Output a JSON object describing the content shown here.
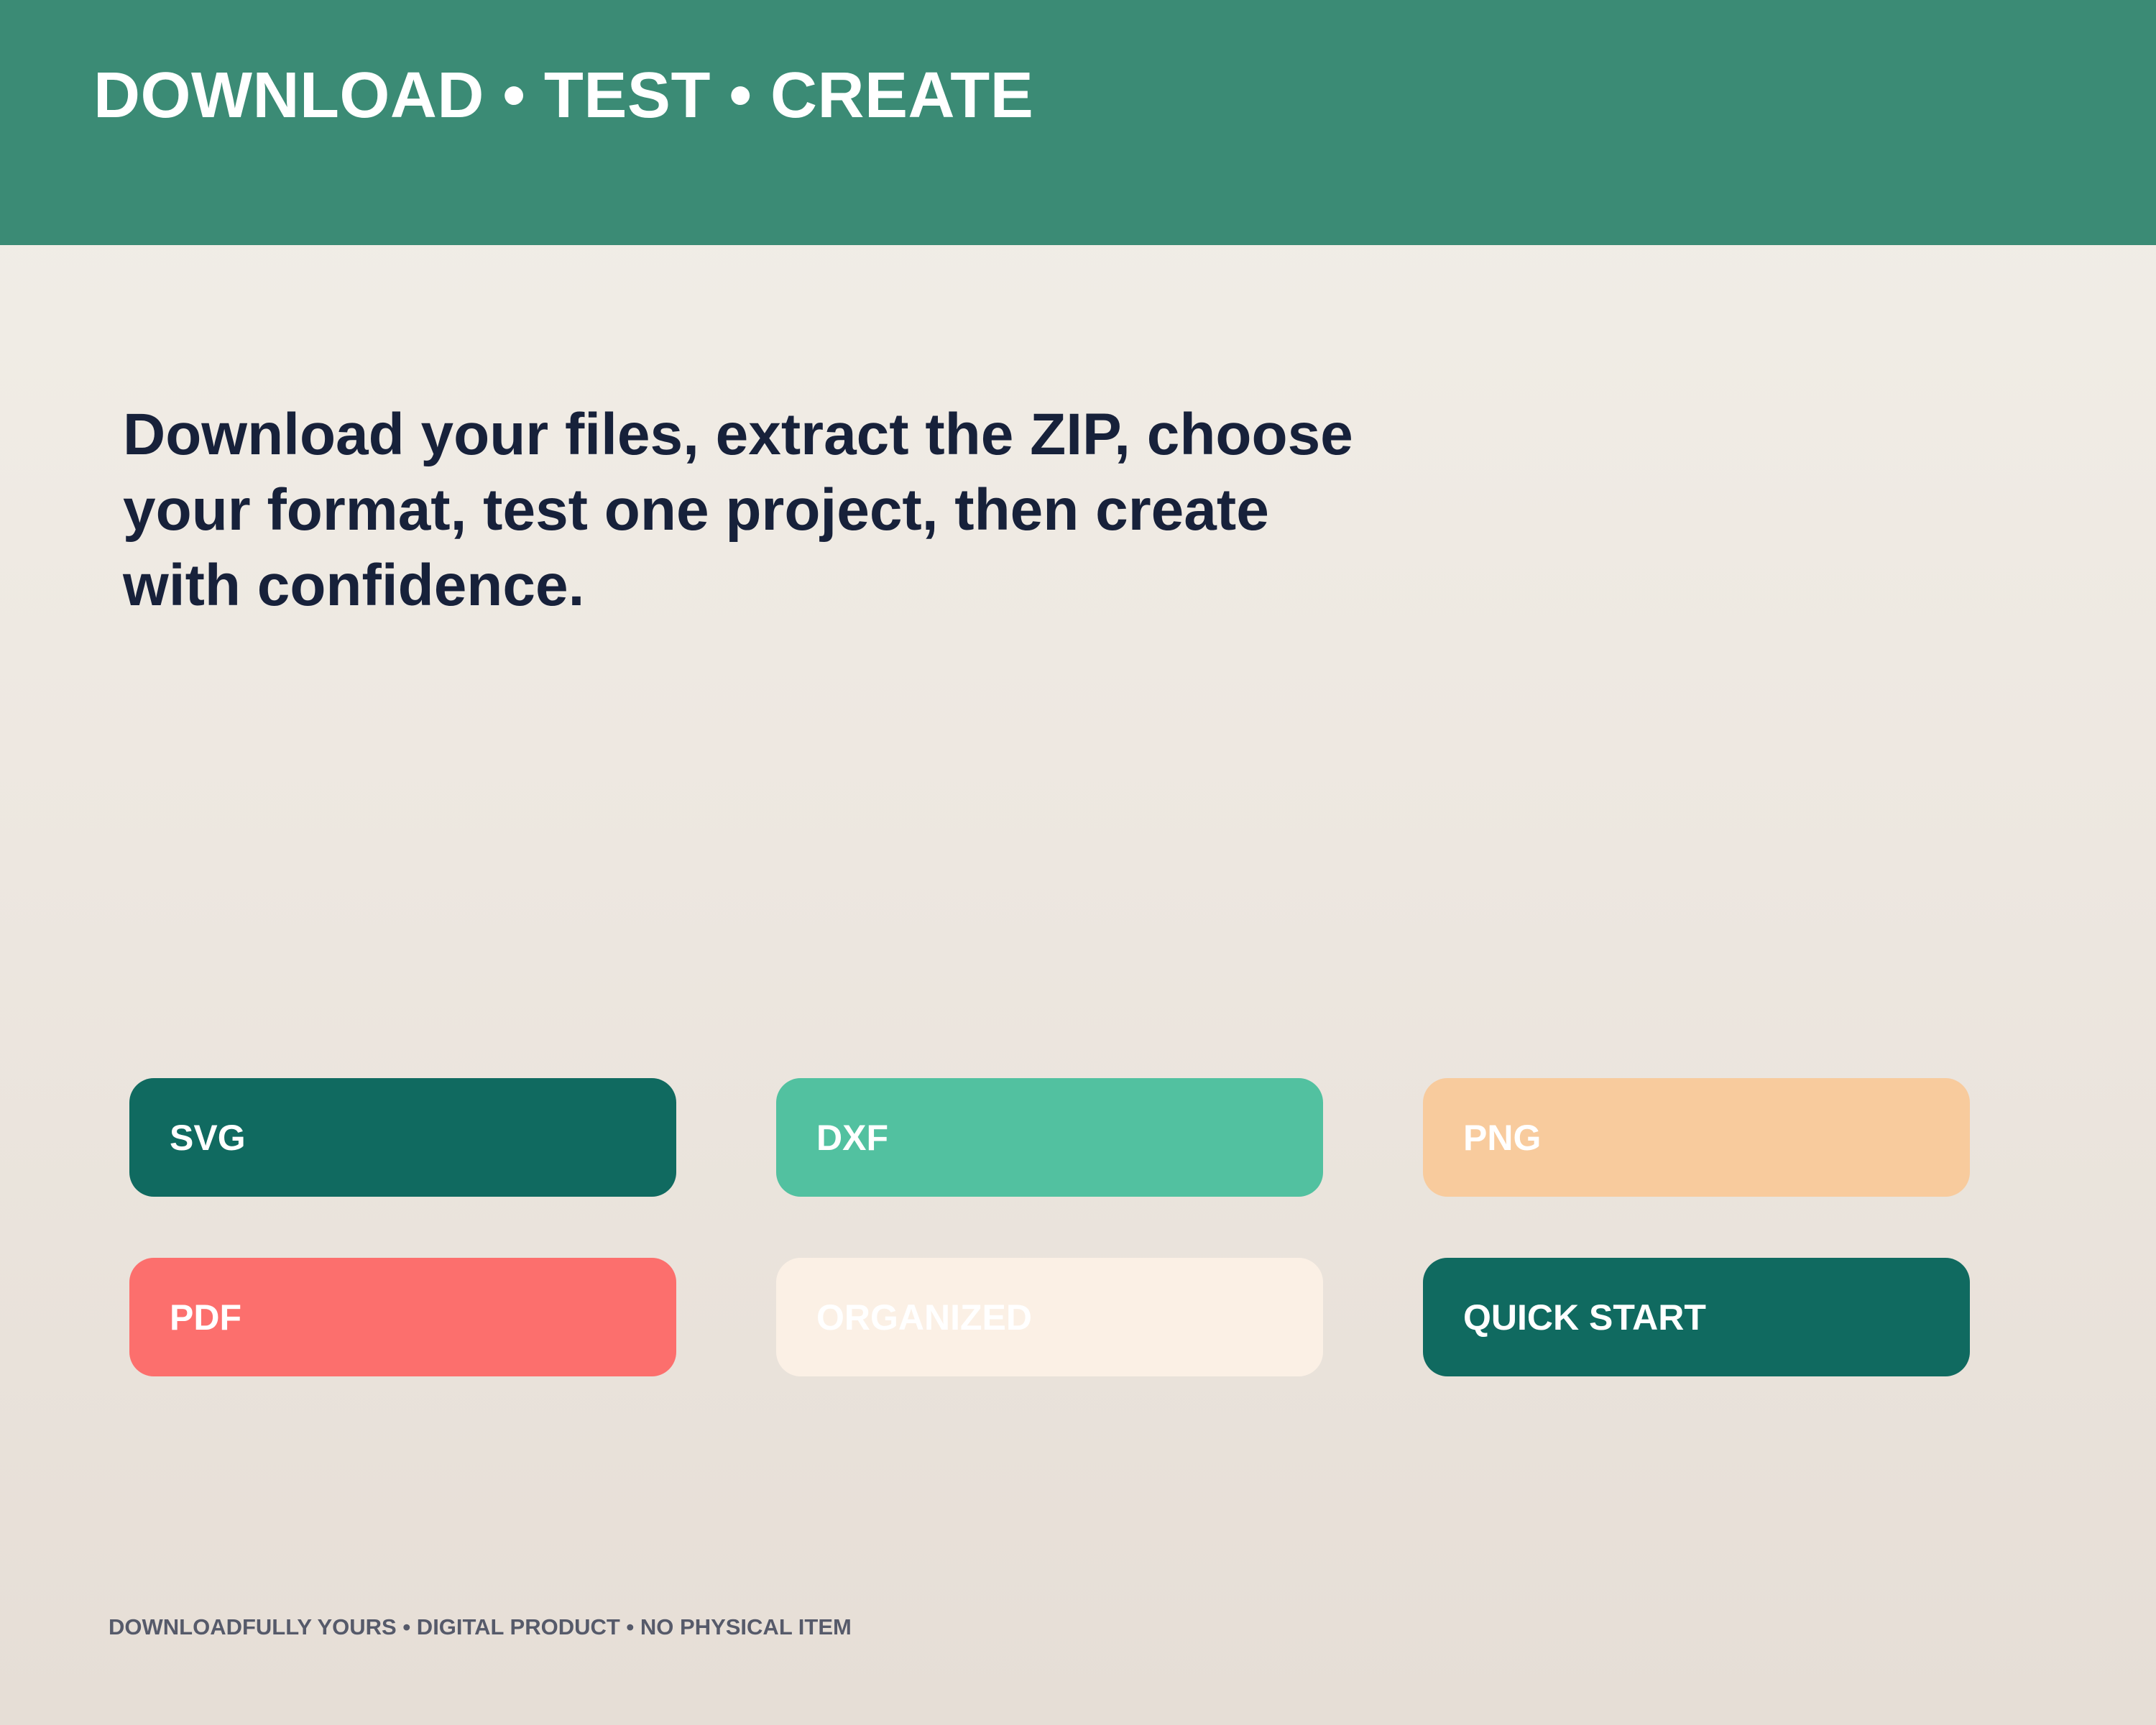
{
  "header": {
    "title": "DOWNLOAD • TEST • CREATE"
  },
  "main": {
    "headline": "Download your files, extract the ZIP, choose your format, test one project, then create with confidence."
  },
  "tiles": [
    {
      "label": "SVG",
      "color": "#106a60"
    },
    {
      "label": "DXF",
      "color": "#52c1a0"
    },
    {
      "label": "PNG",
      "color": "#f8cb9d"
    },
    {
      "label": "PDF",
      "color": "#fc6f6d"
    },
    {
      "label": "ORGANIZED",
      "color": "#fbf0e5"
    },
    {
      "label": "QUICK START",
      "color": "#106a60"
    }
  ],
  "footer": {
    "text": "DOWNLOADFULLY YOURS • DIGITAL PRODUCT • NO PHYSICAL ITEM"
  }
}
